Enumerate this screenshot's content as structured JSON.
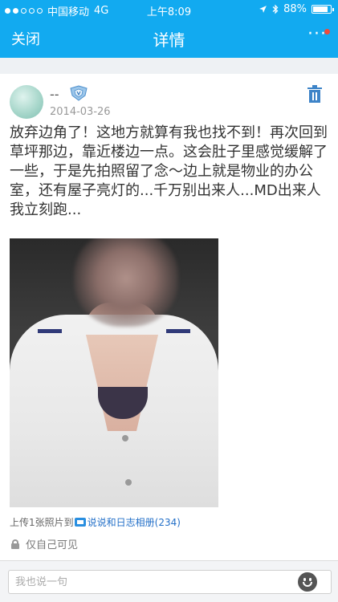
{
  "status_bar": {
    "carrier": "中国移动",
    "network": "4G",
    "time": "上午8:09",
    "battery": "88%",
    "battery_level": 0.88
  },
  "nav": {
    "close_label": "关闭",
    "title": "详情",
    "more_label": "···"
  },
  "post": {
    "username": "--",
    "date": "2014-03-26",
    "content": "放弃边角了！这地方就算有我也找不到！再次回到草坪那边，靠近楼边一点。这会肚子里感觉缓解了一些，于是先拍照留了念～边上就是物业的办公室，还有屋子亮灯的...千万别出来人...MD出来人我立刻跑...",
    "upload_prefix": "上传1张照片到",
    "album_link": "说说和日志相册(234)",
    "privacy": "仅自己可见"
  },
  "comment": {
    "placeholder": "我也说一句"
  },
  "colors": {
    "brand_blue": "#12aaf0",
    "link_blue": "#2470c8",
    "notification_red": "#f04a3a"
  }
}
